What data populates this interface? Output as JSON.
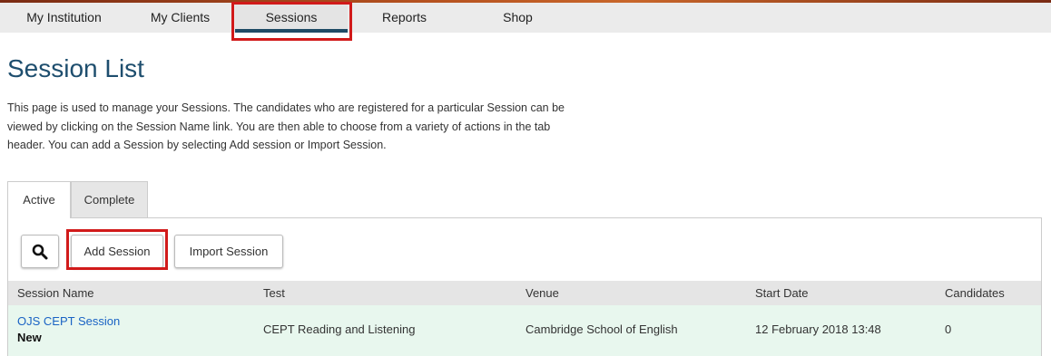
{
  "nav": {
    "items": [
      {
        "label": "My Institution"
      },
      {
        "label": "My Clients"
      },
      {
        "label": "Sessions"
      },
      {
        "label": "Reports"
      },
      {
        "label": "Shop"
      }
    ],
    "active": "Sessions"
  },
  "page": {
    "title": "Session List",
    "intro_lines": [
      "This page is used to manage your Sessions. The candidates who are registered for a particular Session can be",
      "viewed by clicking on the Session Name link. You are then able to choose from a variety of actions in the tab",
      "header. You can add a Session by selecting Add session or Import Session."
    ]
  },
  "tabs": [
    {
      "label": "Active"
    },
    {
      "label": "Complete"
    }
  ],
  "toolbar": {
    "search_icon": "search-icon",
    "add_label": "Add Session",
    "import_label": "Import Session"
  },
  "table": {
    "headers": [
      "Session Name",
      "Test",
      "Venue",
      "Start Date",
      "Candidates"
    ],
    "rows": [
      {
        "name": "OJS CEPT Session",
        "status": "New",
        "test": "CEPT Reading and Listening",
        "venue": "Cambridge School of English",
        "start_date": "12 February 2018 13:48",
        "candidates": "0"
      }
    ]
  },
  "colors": {
    "title": "#1e4e6e",
    "link": "#1a63c4",
    "highlight": "#d11a1a",
    "row_bg": "#e8f7ee",
    "active_tab_underline": "#1f4b66"
  }
}
